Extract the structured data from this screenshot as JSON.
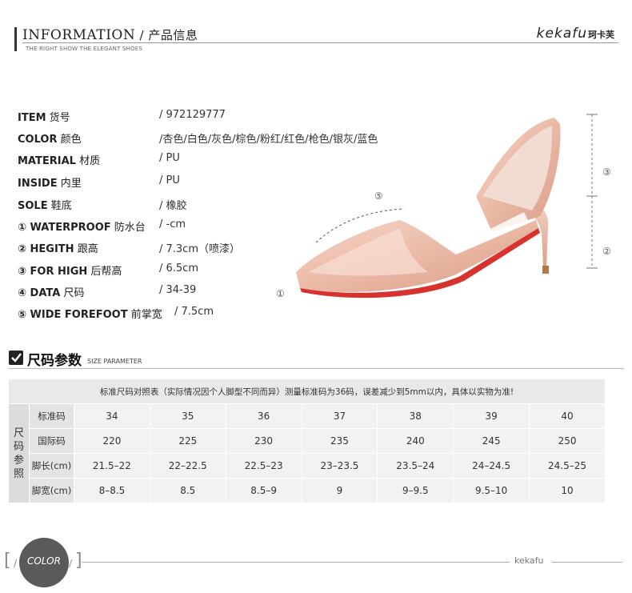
{
  "header": {
    "title_en": "INFORMATION",
    "title_sep": " / ",
    "title_cn": "产品信息",
    "subtitle": "THE RIGHT SHOW THE ELEGANT SHOES",
    "brand_en": "kekafu",
    "brand_cn": "珂卡芙"
  },
  "specs": [
    {
      "key": "ITEM",
      "cn": " 货号",
      "value": "/ 972129777"
    },
    {
      "key": "COLOR",
      "cn": " 颜色",
      "value": "/杏色/白色/灰色/棕色/粉红/红色/枪色/银灰/蓝色"
    },
    {
      "key": "MATERIAL",
      "cn": " 材质",
      "value": "/ PU"
    },
    {
      "key": "INSIDE",
      "cn": " 内里",
      "value": "/ PU"
    },
    {
      "key": "SOLE",
      "cn": " 鞋底",
      "value": "/ 橡胶"
    },
    {
      "key": "① WATERPROOF",
      "cn": " 防水台",
      "value": "/ -cm"
    },
    {
      "key": "② HEGITH",
      "cn": " 跟高",
      "value": "/ 7.3cm（喷漆）"
    },
    {
      "key": "③ FOR HIGH",
      "cn": "  后帮高",
      "value": "/ 6.5cm"
    },
    {
      "key": "④ DATA",
      "cn": "  尺码",
      "value": "/ 34-39"
    },
    {
      "key": "⑤  WIDE FOREFOOT",
      "cn": " 前掌宽",
      "value": "/ 7.5cm"
    }
  ],
  "markers": {
    "m1": "①",
    "m2": "②",
    "m3": "③",
    "m5": "⑤"
  },
  "size_section": {
    "title": "尺码参数",
    "subtitle": "SIZE PARAMETER",
    "notice": "标准尺码对照表（实际情况因个人脚型不同而异）测量标准码为36码，误差减少到5mm以内，具体以实物为准!",
    "vertical_label": [
      "尺",
      "码",
      "参",
      "照"
    ],
    "rows": [
      {
        "label": "标准码",
        "cells": [
          "34",
          "35",
          "36",
          "37",
          "38",
          "39",
          "40"
        ]
      },
      {
        "label": "国际码",
        "cells": [
          "220",
          "225",
          "230",
          "235",
          "240",
          "245",
          "250"
        ]
      },
      {
        "label": "脚长(cm)",
        "cells": [
          "21.5–22",
          "22–22.5",
          "22.5–23",
          "23–23.5",
          "23.5–24",
          "24–24.5",
          "24.5–25"
        ]
      },
      {
        "label": "脚宽(cm)",
        "cells": [
          "8–8.5",
          "8.5",
          "8.5–9",
          "9",
          "9–9.5",
          "9.5–10",
          "10"
        ]
      }
    ]
  },
  "footer": {
    "label": "COLOR",
    "brand": "kekafu",
    "bracket_open": "[",
    "bracket_close": "]",
    "slash": "/"
  },
  "colors": {
    "shoe": "#e9b9a6",
    "sole": "#d8322e",
    "heel_tip": "#b07a48",
    "dark": "#222222"
  }
}
